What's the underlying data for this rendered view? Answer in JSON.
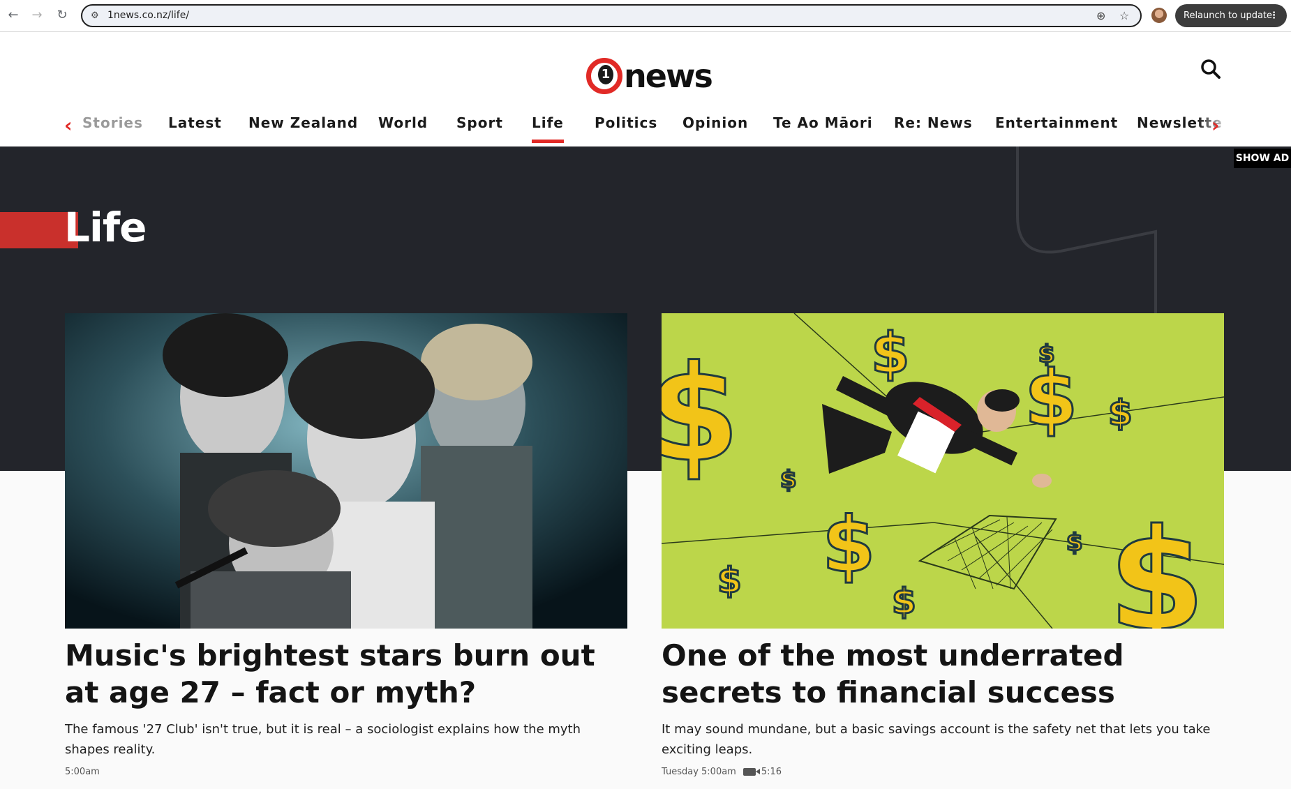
{
  "browser": {
    "url": "1news.co.nz/life/",
    "relaunch_label": "Relaunch to update"
  },
  "header": {
    "logo_numeral": "1",
    "logo_word": "news"
  },
  "nav": {
    "items": [
      {
        "label": "Stories",
        "state": "faded"
      },
      {
        "label": "Latest"
      },
      {
        "label": "New Zealand"
      },
      {
        "label": "World"
      },
      {
        "label": "Sport"
      },
      {
        "label": "Life",
        "state": "active"
      },
      {
        "label": "Politics"
      },
      {
        "label": "Opinion"
      },
      {
        "label": "Te Ao Māori"
      },
      {
        "label": "Re: News"
      },
      {
        "label": "Entertainment"
      },
      {
        "label": "Newslette",
        "state": "faded-end"
      }
    ]
  },
  "hero": {
    "section_title": "Life",
    "show_ad_label": "SHOW AD"
  },
  "articles": [
    {
      "title": "Music's brightest stars burn out at age 27 – fact or myth?",
      "description": "The famous '27 Club' isn't true, but it is real – a sociologist explains how the myth shapes reality.",
      "time": "5:00am"
    },
    {
      "title": "One of the most underrated secrets to financial success",
      "description": "It may sound mundane, but a basic savings account is the safety net that lets you take exciting leaps.",
      "time": "Tuesday 5:00am",
      "video_duration": "5:16"
    }
  ],
  "colors": {
    "brand_red": "#e12a26",
    "hero_bg": "#23252b"
  }
}
